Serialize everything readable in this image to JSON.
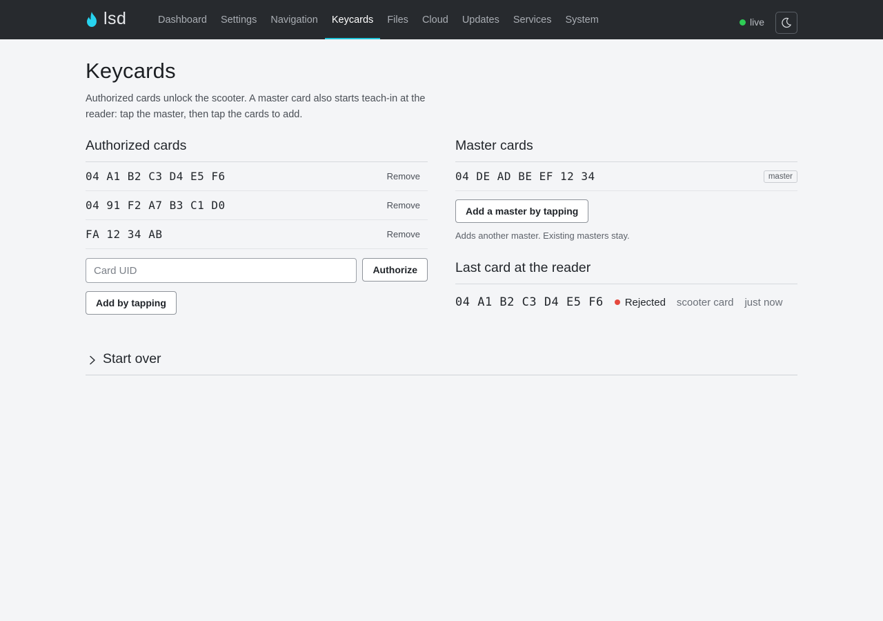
{
  "app": {
    "name": "lsd"
  },
  "nav": {
    "items": [
      {
        "label": "Dashboard"
      },
      {
        "label": "Settings"
      },
      {
        "label": "Navigation"
      },
      {
        "label": "Keycards"
      },
      {
        "label": "Files"
      },
      {
        "label": "Cloud"
      },
      {
        "label": "Updates"
      },
      {
        "label": "Services"
      },
      {
        "label": "System"
      }
    ],
    "active": "Keycards"
  },
  "status": {
    "label": "live",
    "color": "#2ecc55"
  },
  "theme_toggle": {
    "icon": "moon-icon"
  },
  "page": {
    "title": "Keycards",
    "intro": "Authorized cards unlock the scooter. A master card also starts teach-in at the reader: tap the master, then tap the cards to add."
  },
  "authorized": {
    "title": "Authorized cards",
    "cards": [
      {
        "uid": "04 A1 B2 C3 D4 E5 F6",
        "remove_label": "Remove"
      },
      {
        "uid": "04 91 F2 A7 B3 C1 D0",
        "remove_label": "Remove"
      },
      {
        "uid": "FA 12 34 AB",
        "remove_label": "Remove"
      }
    ],
    "input_placeholder": "Card UID",
    "authorize_label": "Authorize",
    "tap_label": "Add by tapping"
  },
  "master": {
    "title": "Master cards",
    "cards": [
      {
        "uid": "04 DE AD BE EF 12 34",
        "badge": "master"
      }
    ],
    "add_label": "Add a master by tapping",
    "hint": "Adds another master. Existing masters stay."
  },
  "last_card": {
    "title": "Last card at the reader",
    "uid": "04 A1 B2 C3 D4 E5 F6",
    "result": "Rejected",
    "result_color": "#e5483d",
    "type": "scooter card",
    "time": "just now"
  },
  "start_over": {
    "label": "Start over"
  }
}
